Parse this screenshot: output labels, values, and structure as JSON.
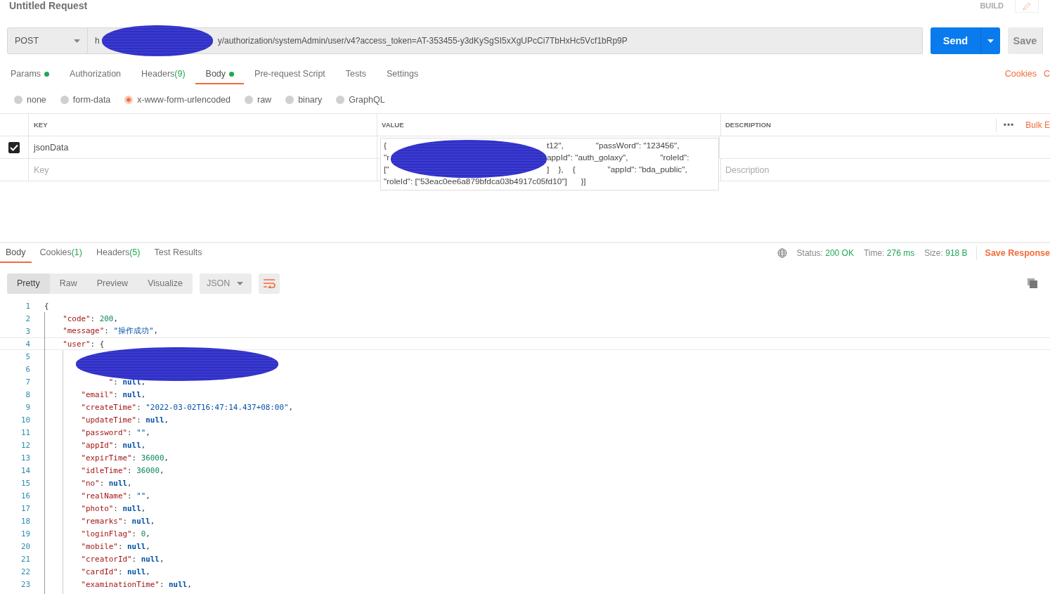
{
  "title": "Untitled Request",
  "build_label": "BUILD",
  "request": {
    "method": "POST",
    "url_before": "h",
    "url_after": "y/authorization/systemAdmin/user/v4?access_token=AT-353455-y3dKySgSI5xXgUPcCi7TbHxHc5Vcf1bRp9P",
    "send": "Send",
    "save": "Save"
  },
  "request_tabs": [
    {
      "label": "Params",
      "dot": true,
      "selected": false
    },
    {
      "label": "Authorization",
      "dot": false,
      "selected": false
    },
    {
      "label": "Headers",
      "count": "(9)",
      "dot": false,
      "selected": false
    },
    {
      "label": "Body",
      "dot": true,
      "selected": true
    },
    {
      "label": "Pre-request Script",
      "dot": false,
      "selected": false
    },
    {
      "label": "Tests",
      "dot": false,
      "selected": false
    },
    {
      "label": "Settings",
      "dot": false,
      "selected": false
    }
  ],
  "request_links": [
    "Cookies",
    "C"
  ],
  "body_types": [
    {
      "label": "none",
      "selected": false
    },
    {
      "label": "form-data",
      "selected": false
    },
    {
      "label": "x-www-form-urlencoded",
      "selected": true
    },
    {
      "label": "raw",
      "selected": false
    },
    {
      "label": "binary",
      "selected": false
    },
    {
      "label": "GraphQL",
      "selected": false
    }
  ],
  "params_table": {
    "columns": [
      "KEY",
      "VALUE",
      "DESCRIPTION"
    ],
    "more": "•••",
    "bulk_edit": "Bulk E",
    "row": {
      "checked": true,
      "key": "jsonData",
      "value_lines": [
        {
          "before": "{",
          "after": "t12\",              \"passWord\": \"123456\","
        },
        {
          "before": "\"r",
          "after": "appId\": \"auth_golaxy\",              \"roleId\":"
        },
        {
          "before": "[\"",
          "after": "]    },    {              \"appId\": \"bda_public\","
        },
        {
          "before": "\"roleId\": [\"53eac0ee6a879bfdca03b4917c05fd10\"]      }]"
        }
      ]
    },
    "new_row": {
      "key_placeholder": "Key",
      "description_placeholder": "Description"
    }
  },
  "response_tabs": [
    {
      "label": "Body",
      "selected": true
    },
    {
      "label": "Cookies",
      "count": "(1)",
      "selected": false
    },
    {
      "label": "Headers",
      "count": "(5)",
      "selected": false
    },
    {
      "label": "Test Results",
      "selected": false
    }
  ],
  "response_stats": [
    {
      "label": "Status:",
      "value": "200 OK"
    },
    {
      "label": "Time:",
      "value": "276 ms"
    },
    {
      "label": "Size:",
      "value": "918 B"
    }
  ],
  "save_response": "Save Response",
  "formats": [
    {
      "label": "Pretty",
      "selected": true
    },
    {
      "label": "Raw",
      "selected": false
    },
    {
      "label": "Preview",
      "selected": false
    },
    {
      "label": "Visualize",
      "selected": false
    }
  ],
  "language": "JSON",
  "code_lines": [
    {
      "n": "1",
      "val": "{",
      "kind": "punct",
      "current": false
    },
    {
      "n": "2",
      "key": "    \"code\"",
      "sep": ": ",
      "val": "200",
      "end": ",",
      "kind": "number",
      "current": false
    },
    {
      "n": "3",
      "key": "    \"message\"",
      "sep": ": ",
      "val": "\"操作成功\"",
      "end": ",",
      "kind": "string",
      "current": false
    },
    {
      "n": "4",
      "key": "    \"user\"",
      "sep": ": ",
      "val": "{",
      "kind": "punct",
      "current": true
    },
    {
      "n": "5",
      "current": false
    },
    {
      "n": "6",
      "current": false
    },
    {
      "n": "7",
      "key": "              \"",
      "sep": ": ",
      "val": "null",
      "end": ",",
      "kind": "null",
      "current": false
    },
    {
      "n": "8",
      "key": "        \"email\"",
      "sep": ": ",
      "val": "null",
      "end": ",",
      "kind": "null",
      "current": false
    },
    {
      "n": "9",
      "key": "        \"createTime\"",
      "sep": ": ",
      "val": "\"2022-03-02T16:47:14.437+08:00\"",
      "end": ",",
      "kind": "string",
      "current": false
    },
    {
      "n": "10",
      "key": "        \"updateTime\"",
      "sep": ": ",
      "val": "null",
      "end": ",",
      "kind": "null",
      "current": false
    },
    {
      "n": "11",
      "key": "        \"password\"",
      "sep": ": ",
      "val": "\"\"",
      "end": ",",
      "kind": "string",
      "current": false
    },
    {
      "n": "12",
      "key": "        \"appId\"",
      "sep": ": ",
      "val": "null",
      "end": ",",
      "kind": "null",
      "current": false
    },
    {
      "n": "13",
      "key": "        \"expirTime\"",
      "sep": ": ",
      "val": "36000",
      "end": ",",
      "kind": "number",
      "current": false
    },
    {
      "n": "14",
      "key": "        \"idleTime\"",
      "sep": ": ",
      "val": "36000",
      "end": ",",
      "kind": "number",
      "current": false
    },
    {
      "n": "15",
      "key": "        \"no\"",
      "sep": ": ",
      "val": "null",
      "end": ",",
      "kind": "null",
      "current": false
    },
    {
      "n": "16",
      "key": "        \"realName\"",
      "sep": ": ",
      "val": "\"\"",
      "end": ",",
      "kind": "string",
      "current": false
    },
    {
      "n": "17",
      "key": "        \"photo\"",
      "sep": ": ",
      "val": "null",
      "end": ",",
      "kind": "null",
      "current": false
    },
    {
      "n": "18",
      "key": "        \"remarks\"",
      "sep": ": ",
      "val": "null",
      "end": ",",
      "kind": "null",
      "current": false
    },
    {
      "n": "19",
      "key": "        \"loginFlag\"",
      "sep": ": ",
      "val": "0",
      "end": ",",
      "kind": "number",
      "current": false
    },
    {
      "n": "20",
      "key": "        \"mobile\"",
      "sep": ": ",
      "val": "null",
      "end": ",",
      "kind": "null",
      "current": false
    },
    {
      "n": "21",
      "key": "        \"creatorId\"",
      "sep": ": ",
      "val": "null",
      "end": ",",
      "kind": "null",
      "current": false
    },
    {
      "n": "22",
      "key": "        \"cardId\"",
      "sep": ": ",
      "val": "null",
      "end": ",",
      "kind": "null",
      "current": false
    },
    {
      "n": "23",
      "key": "        \"examinationTime\"",
      "sep": ": ",
      "val": "null",
      "end": ",",
      "kind": "null",
      "current": false
    }
  ]
}
